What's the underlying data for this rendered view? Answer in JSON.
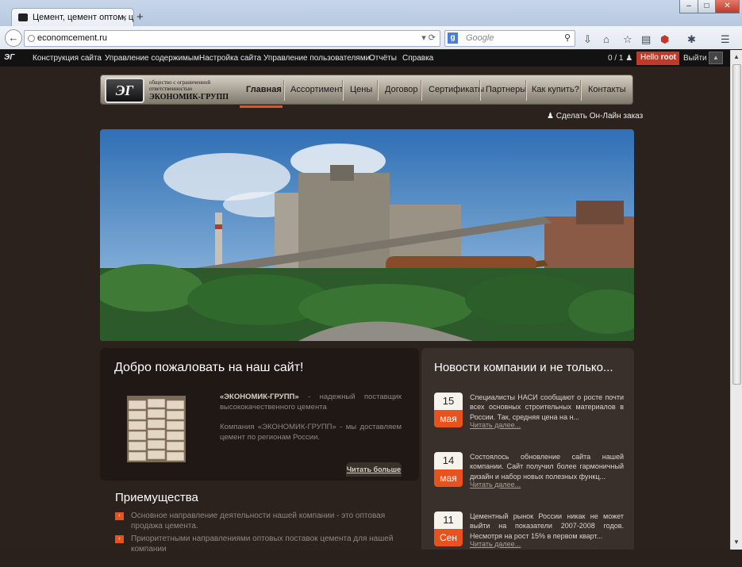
{
  "browser": {
    "tab_title": "Цемент, цемент оптом, ц...",
    "tab_close": "×",
    "new_tab": "+",
    "url": "economcement.ru",
    "search_placeholder": "Google",
    "search_engine_letter": "g",
    "window_buttons": [
      "–",
      "□",
      "✕"
    ]
  },
  "admin_bar": {
    "logo": "ЭГ",
    "items": [
      "Конструкция сайта",
      "Управление содержимым",
      "Настройка сайта",
      "Управление пользователями",
      "Отчёты",
      "Справка"
    ],
    "counter": "0 / 1",
    "hello": "Hello",
    "user": "root",
    "logout": "Выйти"
  },
  "site": {
    "logo_mark": "ЭГ",
    "logo_sub": "общество с ограниченной ответственностью",
    "logo_name": "ЭКОНОМИК-ГРУПП",
    "nav": [
      "Главная",
      "Ассортимент",
      "Цены",
      "Договор",
      "Сертификаты",
      "Партнеры",
      "Как купить?",
      "Контакты"
    ],
    "active_nav": "Главная",
    "order_link": "Сделать Он-Лайн заказ"
  },
  "welcome": {
    "title": "Добро пожаловать на наш сайт!",
    "p1_strong": "«ЭКОНОМИК-ГРУПП»",
    "p1_rest": " - надежный поставщик высококачественного цемента",
    "p2": "Компания «ЭКОНОМИК-ГРУПП» - мы доставляем цемент по регионам России.",
    "more": "Читать больше"
  },
  "advantages": {
    "title": "Приемущества",
    "bullet": "›",
    "items": [
      "Основное направление деятельности нашей компании - это оптовая продажа цемента.",
      "Приоритетными направлениями оптовых поставок цемента для нашей компании"
    ]
  },
  "news": {
    "title": "Новости компании и не только...",
    "read_more": "Читать далее...",
    "items": [
      {
        "day": "15",
        "month": "мая",
        "text": "Специалисты НАСИ сообщают о росте почти всех основных строительных материалов в России. Так, средняя цена на н..."
      },
      {
        "day": "14",
        "month": "мая",
        "text": "Состоялось обновление сайта нашей компании. Сайт получил более гармоничный дизайн и набор новых полезных функц..."
      },
      {
        "day": "11",
        "month": "Сен",
        "text": "Цементный рынок России никак не может выйти на показатели 2007-2008 годов. Несмотря на рост 15% в первом кварт..."
      }
    ]
  },
  "colors": {
    "accent": "#e8521c",
    "page_bg": "#2b221e",
    "admin_bar": "#121212",
    "hello_bg": "#c0392b"
  }
}
